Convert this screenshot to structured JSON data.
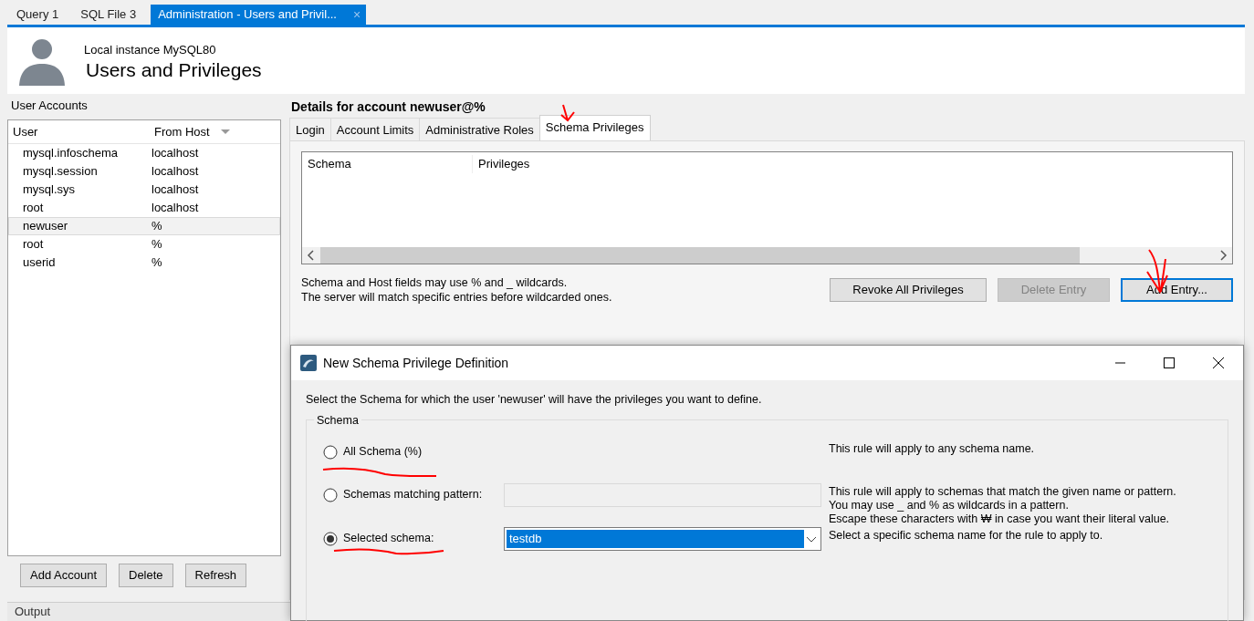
{
  "tabs": [
    {
      "label": "Query 1",
      "selected": false
    },
    {
      "label": "SQL File 3",
      "selected": false
    },
    {
      "label": "Administration - Users and Privil...",
      "selected": true,
      "close": "×"
    }
  ],
  "header": {
    "instance": "Local instance MySQL80",
    "title": "Users and Privileges"
  },
  "user_accounts": {
    "label": "User Accounts",
    "columns": [
      "User",
      "From Host"
    ],
    "rows": [
      {
        "user": "mysql.infoschema",
        "host": "localhost",
        "selected": false
      },
      {
        "user": "mysql.session",
        "host": "localhost",
        "selected": false
      },
      {
        "user": "mysql.sys",
        "host": "localhost",
        "selected": false
      },
      {
        "user": "root",
        "host": "localhost",
        "selected": false
      },
      {
        "user": "newuser",
        "host": "%",
        "selected": true
      },
      {
        "user": "root",
        "host": "%",
        "selected": false
      },
      {
        "user": "userid",
        "host": "%",
        "selected": false
      }
    ],
    "buttons": [
      "Add Account",
      "Delete",
      "Refresh"
    ]
  },
  "details": {
    "heading": "Details for account newuser@%",
    "tabs": [
      {
        "label": "Login",
        "selected": false
      },
      {
        "label": "Account Limits",
        "selected": false
      },
      {
        "label": "Administrative Roles",
        "selected": false
      },
      {
        "label": "Schema Privileges",
        "selected": true
      }
    ],
    "table": {
      "columns": [
        "Schema",
        "Privileges"
      ]
    },
    "notes": [
      "Schema and Host fields may use % and _ wildcards.",
      "The server will match specific entries before wildcarded ones."
    ],
    "buttons": [
      {
        "label": "Revoke All Privileges",
        "disabled": false,
        "default": false
      },
      {
        "label": "Delete Entry",
        "disabled": true,
        "default": false
      },
      {
        "label": "Add Entry...",
        "disabled": false,
        "default": true
      }
    ]
  },
  "output": {
    "label": "Output"
  },
  "dialog": {
    "title": "New Schema Privilege Definition",
    "prompt": "Select the Schema for which the user 'newuser' will have the privileges you want to define.",
    "group": "Schema",
    "options": [
      {
        "kind": "plain",
        "label": "All Schema (%)",
        "selected": false,
        "description": [
          "This rule will apply to any schema name."
        ]
      },
      {
        "kind": "text",
        "label": "Schemas matching pattern:",
        "selected": false,
        "description": [
          "This rule will apply to schemas that match the given name or pattern.",
          "You may use _ and % as wildcards in a pattern.",
          "Escape these characters with ₩ in case you want their literal value."
        ]
      },
      {
        "kind": "select",
        "label": "Selected schema:",
        "selected": true,
        "value": "testdb",
        "description": [
          "Select a specific schema name for the rule to apply to."
        ]
      }
    ]
  }
}
